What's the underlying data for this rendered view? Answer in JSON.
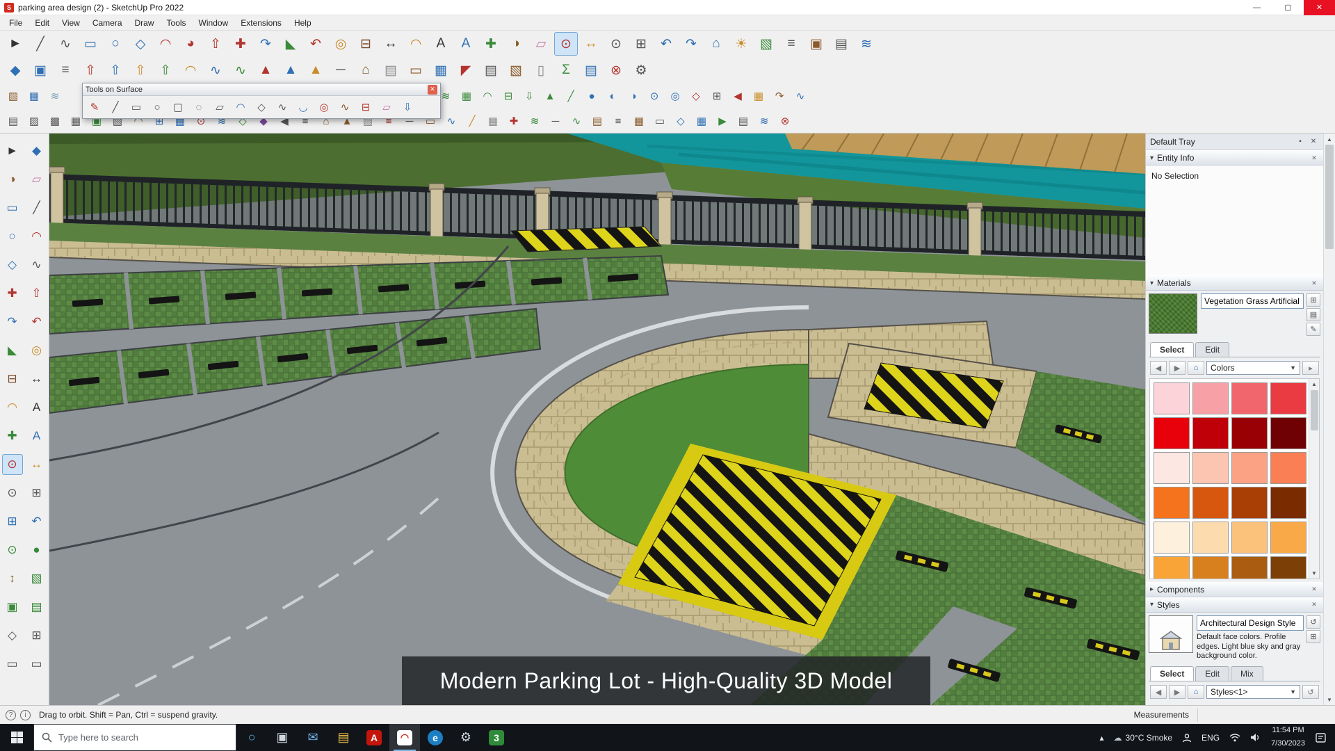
{
  "window": {
    "title": "parking area design (2) - SketchUp Pro 2022"
  },
  "menu_bar": {
    "items": [
      "File",
      "Edit",
      "View",
      "Camera",
      "Draw",
      "Tools",
      "Window",
      "Extensions",
      "Help"
    ]
  },
  "toolbars": {
    "row1": [
      [
        "select",
        "►",
        "#333333"
      ],
      [
        "line",
        "╱",
        "#555555"
      ],
      [
        "freehand",
        "∿",
        "#555555"
      ],
      [
        "rectangle",
        "▭",
        "#2f6fb3"
      ],
      [
        "circle",
        "○",
        "#2f6fb3"
      ],
      [
        "polygon",
        "◇",
        "#2f6fb3"
      ],
      [
        "arc",
        "◠",
        "#b3342e"
      ],
      [
        "pie",
        "◕",
        "#b3342e"
      ],
      [
        "push-pull",
        "⇧",
        "#b3342e"
      ],
      [
        "move",
        "✚",
        "#b3342e"
      ],
      [
        "rotate",
        "↷",
        "#2f6fb3"
      ],
      [
        "scale",
        "◣",
        "#3a8a3a"
      ],
      [
        "follow-me",
        "↶",
        "#b3342e"
      ],
      [
        "offset",
        "◎",
        "#c98b2a"
      ],
      [
        "tape-measure",
        "⊟",
        "#7a4a2a"
      ],
      [
        "dimension",
        "↔",
        "#333333"
      ],
      [
        "protractor",
        "◠",
        "#c98b2a"
      ],
      [
        "text",
        "A",
        "#333333"
      ],
      [
        "3d-text",
        "A",
        "#2f6fb3"
      ],
      [
        "axes",
        "✚",
        "#3a8a3a"
      ],
      [
        "paint-bucket",
        "◑",
        "#8a5a2a"
      ],
      [
        "eraser",
        "▱",
        "#c27ba0"
      ],
      [
        "orbit",
        "⊙",
        "#b3342e",
        true
      ],
      [
        "pan",
        "↔",
        "#c98b2a"
      ],
      [
        "zoom",
        "⊙",
        "#555555"
      ],
      [
        "zoom-extents",
        "⊞",
        "#555555"
      ],
      [
        "previous-view",
        "↶",
        "#2f6fb3"
      ],
      [
        "next-view",
        "↷",
        "#2f6fb3"
      ],
      [
        "views",
        "⌂",
        "#2f6fb3"
      ],
      [
        "shadows",
        "☀",
        "#c98b2a"
      ],
      [
        "section-plane",
        "▧",
        "#3a8a3a"
      ],
      [
        "model-info",
        "≡",
        "#555555"
      ],
      [
        "materials-browser",
        "▣",
        "#8a5a2a"
      ],
      [
        "styles-browser",
        "▤",
        "#555555"
      ],
      [
        "tags",
        "≋",
        "#2f6fb3"
      ]
    ],
    "row2": [
      [
        "make-component",
        "◆",
        "#2f6fb3"
      ],
      [
        "make-group",
        "▣",
        "#2f6fb3"
      ],
      [
        "outliner",
        "≡",
        "#555555"
      ],
      [
        "jpp-basic",
        "⇧",
        "#b3342e"
      ],
      [
        "jpp-vector",
        "⇧",
        "#2f6fb3"
      ],
      [
        "jpp-normal",
        "⇧",
        "#c98b2a"
      ],
      [
        "jpp-thicken",
        "⇧",
        "#3a8a3a"
      ],
      [
        "round-corner",
        "◠",
        "#c98b2a"
      ],
      [
        "bezier-curve",
        "∿",
        "#2f6fb3"
      ],
      [
        "curve-maker",
        "∿",
        "#3a8a3a"
      ],
      [
        "extrude-edges",
        "▲",
        "#b3342e"
      ],
      [
        "extrude-rails",
        "▲",
        "#2f6fb3"
      ],
      [
        "extrude-faces",
        "▲",
        "#c98b2a"
      ],
      [
        "weld-edges",
        "─",
        "#555555"
      ],
      [
        "house-builder",
        "⌂",
        "#8a5a2a"
      ],
      [
        "wall-tool",
        "▤",
        "#8a8a8a"
      ],
      [
        "door-tool",
        "▭",
        "#8a5a2a"
      ],
      [
        "window-tool",
        "▦",
        "#2f6fb3"
      ],
      [
        "roof-tool",
        "◤",
        "#b3342e"
      ],
      [
        "stair-tool",
        "▤",
        "#555555"
      ],
      [
        "floor-tool",
        "▧",
        "#8a5a2a"
      ],
      [
        "column-tool",
        "▯",
        "#8a8a8a"
      ],
      [
        "estimator",
        "Σ",
        "#3a8a3a"
      ],
      [
        "report-generator",
        "▤",
        "#2f6fb3"
      ],
      [
        "purge-unused",
        "⊗",
        "#b3342e"
      ],
      [
        "model-cleanup",
        "⚙",
        "#555555"
      ]
    ],
    "row3_left": [
      [
        "texture-position",
        "▧",
        "#8a5a2a"
      ],
      [
        "match-photo",
        "▦",
        "#2f6fb3"
      ],
      [
        "fog",
        "≋",
        "#7fa6b8"
      ]
    ],
    "row3_right": [
      [
        "sandbox-from-contours",
        "≋",
        "#3a8a3a"
      ],
      [
        "sandbox-from-scratch",
        "▦",
        "#3a8a3a"
      ],
      [
        "smoove",
        "◠",
        "#3a8a3a"
      ],
      [
        "stamp",
        "⊟",
        "#3a8a3a"
      ],
      [
        "drape",
        "⇩",
        "#3a8a3a"
      ],
      [
        "add-detail",
        "▲",
        "#3a8a3a"
      ],
      [
        "flip-edge",
        "╱",
        "#3a8a3a"
      ],
      [
        "solid-union",
        "●",
        "#2f6fb3"
      ],
      [
        "solid-subtract",
        "◐",
        "#2f6fb3"
      ],
      [
        "solid-trim",
        "◑",
        "#2f6fb3"
      ],
      [
        "solid-intersect",
        "⊙",
        "#2f6fb3"
      ],
      [
        "solid-split",
        "◎",
        "#2f6fb3"
      ],
      [
        "shapes",
        "◇",
        "#b3342e"
      ],
      [
        "grid",
        "⊞",
        "#555555"
      ],
      [
        "mirror",
        "◀",
        "#b3342e"
      ],
      [
        "array",
        "▦",
        "#c98b2a"
      ],
      [
        "lathe",
        "↷",
        "#8a5a2a"
      ],
      [
        "pipe",
        "∿",
        "#2f6fb3"
      ]
    ],
    "row4": [
      [
        "profile-builder",
        "▤",
        "#555555"
      ],
      [
        "hatch-lines",
        "▨",
        "#555555"
      ],
      [
        "hatch-cross",
        "▩",
        "#555555"
      ],
      [
        "hatch-dots",
        "▦",
        "#555555"
      ],
      [
        "section-cut-face",
        "▣",
        "#3a8a3a"
      ],
      [
        "skalp-hatch",
        "▧",
        "#555555"
      ],
      [
        "artisan-sculpt",
        "◠",
        "#8a5a2a"
      ],
      [
        "subdivide",
        "⊞",
        "#2f6fb3"
      ],
      [
        "quad-face",
        "▦",
        "#2f6fb3"
      ],
      [
        "vertex-edit",
        "⊙",
        "#b3342e"
      ],
      [
        "cloth-sim",
        "≋",
        "#2f6fb3"
      ],
      [
        "skimp-import",
        "◇",
        "#3a8a3a"
      ],
      [
        "transmutr",
        "◆",
        "#7a4a9a"
      ],
      [
        "mirror-2",
        "◀",
        "#555555"
      ],
      [
        "align",
        "≡",
        "#555555"
      ],
      [
        "dibac-walls",
        "⌂",
        "#8a5a2a"
      ],
      [
        "medeek-truss",
        "▲",
        "#8a5a2a"
      ],
      [
        "wall-hatch",
        "▨",
        "#8a8a8a"
      ],
      [
        "rebar",
        "≡",
        "#b3342e"
      ],
      [
        "steel-profile",
        "─",
        "#555555"
      ],
      [
        "timber-beam",
        "▭",
        "#8a5a2a"
      ],
      [
        "plumbing",
        "∿",
        "#2f6fb3"
      ],
      [
        "conduit",
        "╱",
        "#c98b2a"
      ],
      [
        "hvac-duct",
        "▦",
        "#8a8a8a"
      ],
      [
        "survey-point",
        "✚",
        "#b3342e"
      ],
      [
        "terrain",
        "≋",
        "#3a8a3a"
      ],
      [
        "road-builder",
        "─",
        "#555555"
      ],
      [
        "path-tool",
        "∿",
        "#3a8a3a"
      ],
      [
        "stair-builder",
        "▤",
        "#8a5a2a"
      ],
      [
        "railing-tool",
        "≡",
        "#555555"
      ],
      [
        "fence-builder",
        "▦",
        "#8a5a2a"
      ],
      [
        "gate-tool",
        "▭",
        "#555555"
      ],
      [
        "export-dwg",
        "◇",
        "#2f6fb3"
      ],
      [
        "export-image",
        "▦",
        "#2f6fb3"
      ],
      [
        "animation-play",
        "▶",
        "#3a8a3a"
      ],
      [
        "scene-manager",
        "▤",
        "#555555"
      ],
      [
        "layers-panel",
        "≋",
        "#2f6fb3"
      ],
      [
        "purge-model",
        "⊗",
        "#b3342e"
      ]
    ],
    "left_rail": [
      [
        "select",
        "►",
        "#333333"
      ],
      [
        "make-component",
        "◆",
        "#2f6fb3"
      ],
      [
        "paint-bucket",
        "◑",
        "#8a5a2a"
      ],
      [
        "eraser",
        "▱",
        "#c27ba0"
      ],
      [
        "rectangle",
        "▭",
        "#2f6fb3"
      ],
      [
        "line",
        "╱",
        "#555555"
      ],
      [
        "circle",
        "○",
        "#2f6fb3"
      ],
      [
        "arc",
        "◠",
        "#b3342e"
      ],
      [
        "polygon",
        "◇",
        "#2f6fb3"
      ],
      [
        "freehand",
        "∿",
        "#555555"
      ],
      [
        "move",
        "✚",
        "#b3342e"
      ],
      [
        "push-pull",
        "⇧",
        "#b3342e"
      ],
      [
        "rotate",
        "↷",
        "#2f6fb3"
      ],
      [
        "follow-me",
        "↶",
        "#b3342e"
      ],
      [
        "scale",
        "◣",
        "#3a8a3a"
      ],
      [
        "offset",
        "◎",
        "#c98b2a"
      ],
      [
        "tape-measure",
        "⊟",
        "#7a4a2a"
      ],
      [
        "dimension",
        "↔",
        "#333333"
      ],
      [
        "protractor",
        "◠",
        "#c98b2a"
      ],
      [
        "text",
        "A",
        "#333333"
      ],
      [
        "axes",
        "✚",
        "#3a8a3a"
      ],
      [
        "3d-text",
        "A",
        "#2f6fb3"
      ],
      [
        "orbit",
        "⊙",
        "#b3342e",
        true
      ],
      [
        "pan",
        "↔",
        "#c98b2a"
      ],
      [
        "zoom",
        "⊙",
        "#555555"
      ],
      [
        "zoom-window",
        "⊞",
        "#555555"
      ],
      [
        "zoom-extents",
        "⊞",
        "#2f6fb3"
      ],
      [
        "previous-view",
        "↶",
        "#2f6fb3"
      ],
      [
        "position-camera",
        "⊙",
        "#3a8a3a"
      ],
      [
        "look-around",
        "●",
        "#3a8a3a"
      ],
      [
        "walk",
        "↕",
        "#8a5a2a"
      ],
      [
        "section-plane",
        "▧",
        "#3a8a3a"
      ],
      [
        "section-fill",
        "▣",
        "#3a8a3a"
      ],
      [
        "section-display",
        "▤",
        "#3a8a3a"
      ],
      [
        "iso-view",
        "◇",
        "#555555"
      ],
      [
        "top-view",
        "⊞",
        "#555555"
      ],
      [
        "front-view",
        "▭",
        "#555555"
      ],
      [
        "right-view",
        "▭",
        "#555555"
      ]
    ]
  },
  "floating_toolbar": {
    "title": "Tools on Surface",
    "icons": [
      [
        "surface-pencil",
        "✎",
        "#b3342e"
      ],
      [
        "surface-line",
        "╱",
        "#555555"
      ],
      [
        "surface-rect",
        "▭",
        "#555555"
      ],
      [
        "surface-ellipse",
        "○",
        "#555555"
      ],
      [
        "surface-rounded-rect",
        "▢",
        "#555555"
      ],
      [
        "surface-oval",
        "◌",
        "#555555"
      ],
      [
        "surface-parallelogram",
        "▱",
        "#555555"
      ],
      [
        "surface-arc",
        "◠",
        "#2f6fb3"
      ],
      [
        "surface-polygon",
        "◇",
        "#555555"
      ],
      [
        "surface-polyline",
        "∿",
        "#555555"
      ],
      [
        "surface-curve",
        "◡",
        "#2f6fb3"
      ],
      [
        "surface-offset",
        "◎",
        "#b3342e"
      ],
      [
        "surface-freehand",
        "∿",
        "#8a5a2a"
      ],
      [
        "surface-measure",
        "⊟",
        "#b3342e"
      ],
      [
        "surface-eraser",
        "▱",
        "#c27ba0"
      ],
      [
        "surface-project",
        "⇩",
        "#2f6fb3"
      ]
    ]
  },
  "viewport": {
    "caption": "Modern Parking Lot - High-Quality 3D Model"
  },
  "tray": {
    "title": "Default Tray",
    "entity_info": {
      "title": "Entity Info",
      "status": "No Selection"
    },
    "materials": {
      "title": "Materials",
      "name_value": "Vegetation Grass Artificial",
      "tabs": [
        "Select",
        "Edit"
      ],
      "active_tab": 0,
      "collection": "Colors",
      "swatches": [
        "#fbd3d8",
        "#f7a1a6",
        "#f0666c",
        "#ea3b42",
        "#e8000b",
        "#c00008",
        "#980005",
        "#6f0003",
        "#fde7e2",
        "#fcc5b2",
        "#fba285",
        "#fa7f55",
        "#f4731c",
        "#d8570e",
        "#a93f05",
        "#7a2b00",
        "#fdf1de",
        "#fcdcae",
        "#fbc27b",
        "#faa948",
        "#f9a437",
        "#d87f1e",
        "#aa5c10",
        "#7c3f06"
      ]
    },
    "components": {
      "title": "Components"
    },
    "styles": {
      "title": "Styles",
      "name_value": "Architectural Design Style",
      "description": "Default face colors. Profile edges. Light blue sky and gray background color.",
      "tabs": [
        "Select",
        "Edit",
        "Mix"
      ],
      "active_tab": 0,
      "collection": "Styles<1>"
    }
  },
  "status_bar": {
    "hint": "Drag to orbit. Shift = Pan, Ctrl = suspend gravity.",
    "measurements_label": "Measurements"
  },
  "taskbar": {
    "search_placeholder": "Type here to search",
    "apps": [
      {
        "name": "cortana",
        "glyph": "○",
        "fg": "#58b7e6"
      },
      {
        "name": "task-view",
        "glyph": "▣",
        "fg": "#cfd8dc"
      },
      {
        "name": "mail",
        "glyph": "✉",
        "fg": "#6fb3e8"
      },
      {
        "name": "file-explorer",
        "glyph": "▤",
        "fg": "#f0c24b"
      },
      {
        "name": "acrobat",
        "glyph": "A",
        "bg": "#c4150c",
        "fg": "#ffffff"
      },
      {
        "name": "sketchup",
        "glyph": "◠",
        "bg": "#ffffff",
        "fg": "#cf2b1e",
        "active": true
      },
      {
        "name": "edge",
        "glyph": "e",
        "bg": "#1c7fc4",
        "fg": "#ffffff",
        "round": true
      },
      {
        "name": "settings",
        "glyph": "⚙",
        "fg": "#cfd8dc"
      },
      {
        "name": "notes3",
        "glyph": "3",
        "bg": "#2e8b3a",
        "fg": "#ffffff"
      }
    ],
    "weather": "30°C Smoke",
    "language": "ENG",
    "time": "11:54 PM",
    "date": "7/30/2023"
  }
}
